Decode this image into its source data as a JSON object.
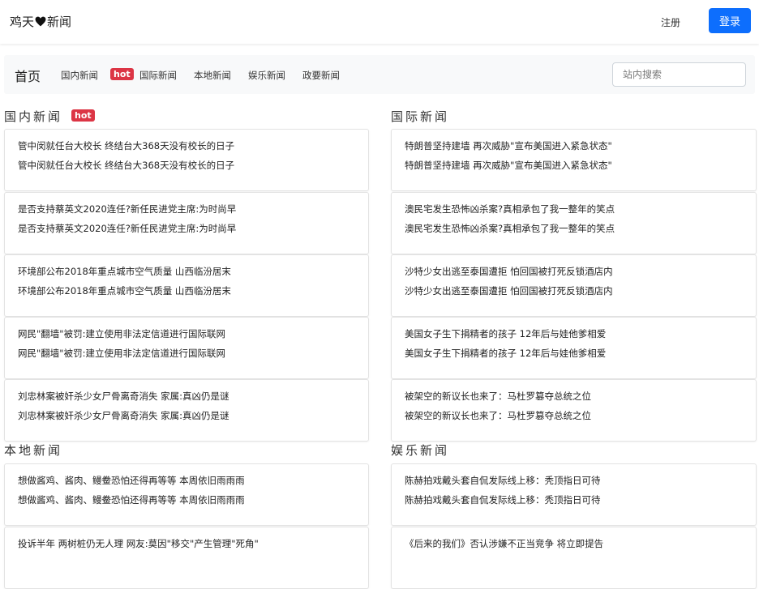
{
  "header": {
    "brand_left": "鸡天",
    "brand_right": "新闻",
    "register": "注册",
    "login": "登录"
  },
  "nav": {
    "home": "首页",
    "links": [
      "国内新闻",
      "国际新闻",
      "本地新闻",
      "娱乐新闻",
      "政要新闻"
    ],
    "hot": "hot",
    "search_placeholder": "站内搜索"
  },
  "sections": {
    "domestic": {
      "title": "国内新闻",
      "hot": "hot",
      "items": [
        {
          "line1": "管中闵就任台大校长 终结台大368天没有校长的日子",
          "line2": "管中闵就任台大校长 终结台大368天没有校长的日子"
        },
        {
          "line1": "是否支持蔡英文2020连任?新任民进党主席:为时尚早",
          "line2": "是否支持蔡英文2020连任?新任民进党主席:为时尚早"
        },
        {
          "line1": "环境部公布2018年重点城市空气质量 山西临汾居末",
          "line2": "环境部公布2018年重点城市空气质量 山西临汾居末"
        },
        {
          "line1": "网民\"翻墙\"被罚:建立使用非法定信道进行国际联网",
          "line2": "网民\"翻墙\"被罚:建立使用非法定信道进行国际联网"
        },
        {
          "line1": "刘忠林案被奸杀少女尸骨离奇消失 家属:真凶仍是谜",
          "line2": "刘忠林案被奸杀少女尸骨离奇消失 家属:真凶仍是谜"
        }
      ]
    },
    "international": {
      "title": "国际新闻",
      "items": [
        {
          "line1": "特朗普坚持建墙 再次威胁\"宣布美国进入紧急状态\"",
          "line2": "特朗普坚持建墙 再次威胁\"宣布美国进入紧急状态\""
        },
        {
          "line1": "澳民宅发生恐怖凶杀案?真相承包了我一整年的笑点",
          "line2": "澳民宅发生恐怖凶杀案?真相承包了我一整年的笑点"
        },
        {
          "line1": "沙特少女出逃至泰国遭拒 怕回国被打死反锁酒店内",
          "line2": "沙特少女出逃至泰国遭拒 怕回国被打死反锁酒店内"
        },
        {
          "line1": "美国女子生下捐精者的孩子 12年后与娃他爹相爱",
          "line2": "美国女子生下捐精者的孩子 12年后与娃他爹相爱"
        },
        {
          "line1": "被架空的新议长也来了：马杜罗篡夺总统之位",
          "line2": "被架空的新议长也来了：马杜罗篡夺总统之位"
        }
      ]
    },
    "local": {
      "title": "本地新闻",
      "items": [
        {
          "line1": "想做酱鸡、酱肉、鳗鲞恐怕还得再等等 本周依旧雨雨雨",
          "line2": "想做酱鸡、酱肉、鳗鲞恐怕还得再等等 本周依旧雨雨雨"
        },
        {
          "line1": "投诉半年 两树桩仍无人理 网友:莫因\"移交\"产生管理\"死角\"",
          "line2": ""
        }
      ]
    },
    "entertainment": {
      "title": "娱乐新闻",
      "items": [
        {
          "line1": "陈赫拍戏戴头套自侃发际线上移：秃顶指日可待",
          "line2": "陈赫拍戏戴头套自侃发际线上移：秃顶指日可待"
        },
        {
          "line1": "《后来的我们》否认涉嫌不正当竞争 将立即提告",
          "line2": ""
        }
      ]
    }
  },
  "colors": {
    "primary": "#0d6efd",
    "hot": "#dc3545",
    "nav_bg": "#f8f9fa"
  }
}
